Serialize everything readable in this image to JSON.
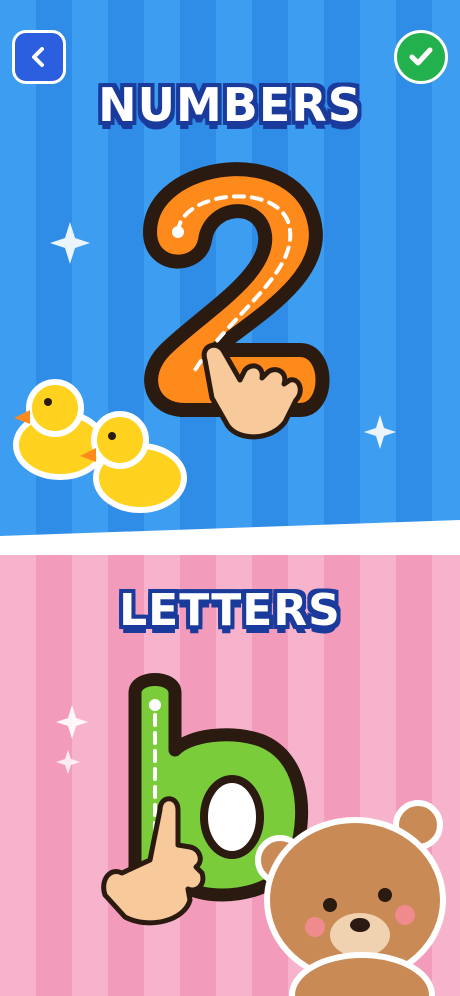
{
  "screen": {
    "numbers_title": "NUMBERS",
    "letters_title": "LETTERS",
    "digit": "2",
    "letter": "b"
  },
  "colors": {
    "top_background": "#3d9df0",
    "bottom_background": "#f7b3cc",
    "digit_fill": "#ff8a1c",
    "letter_fill": "#7acc3a",
    "back_button": "#2b5fe0",
    "check_button": "#22b14c",
    "title_outline": "#1a3a9c"
  },
  "icons": {
    "back": "chevron-left-icon",
    "confirm": "checkmark-icon"
  }
}
